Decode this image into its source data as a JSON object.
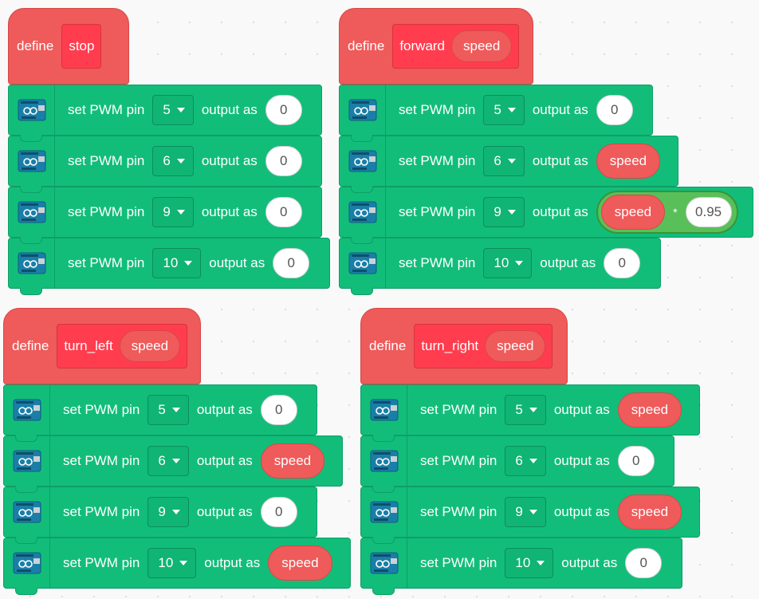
{
  "colors": {
    "motion_block": "#12bd7a",
    "define_hat": "#ef5a5a",
    "prototype": "#ff3d4f",
    "operator": "#59c059"
  },
  "scripts": [
    {
      "define_label": "define",
      "name": "stop",
      "args": [],
      "blocks": [
        {
          "label": "set PWM pin",
          "pin": "5",
          "output_label": "output as",
          "value": {
            "type": "number",
            "text": "0"
          }
        },
        {
          "label": "set PWM pin",
          "pin": "6",
          "output_label": "output as",
          "value": {
            "type": "number",
            "text": "0"
          }
        },
        {
          "label": "set PWM pin",
          "pin": "9",
          "output_label": "output as",
          "value": {
            "type": "number",
            "text": "0"
          }
        },
        {
          "label": "set PWM pin",
          "pin": "10",
          "output_label": "output as",
          "value": {
            "type": "number",
            "text": "0"
          }
        }
      ]
    },
    {
      "define_label": "define",
      "name": "forward",
      "args": [
        "speed"
      ],
      "blocks": [
        {
          "label": "set PWM pin",
          "pin": "5",
          "output_label": "output as",
          "value": {
            "type": "number",
            "text": "0"
          }
        },
        {
          "label": "set PWM pin",
          "pin": "6",
          "output_label": "output as",
          "value": {
            "type": "reporter",
            "text": "speed"
          }
        },
        {
          "label": "set PWM pin",
          "pin": "9",
          "output_label": "output as",
          "value": {
            "type": "operator",
            "left": "speed",
            "operator": "*",
            "right": "0.95"
          }
        },
        {
          "label": "set PWM pin",
          "pin": "10",
          "output_label": "output as",
          "value": {
            "type": "number",
            "text": "0"
          }
        }
      ]
    },
    {
      "define_label": "define",
      "name": "turn_left",
      "args": [
        "speed"
      ],
      "blocks": [
        {
          "label": "set PWM pin",
          "pin": "5",
          "output_label": "output as",
          "value": {
            "type": "number",
            "text": "0"
          }
        },
        {
          "label": "set PWM pin",
          "pin": "6",
          "output_label": "output as",
          "value": {
            "type": "reporter",
            "text": "speed"
          }
        },
        {
          "label": "set PWM pin",
          "pin": "9",
          "output_label": "output as",
          "value": {
            "type": "number",
            "text": "0"
          }
        },
        {
          "label": "set PWM pin",
          "pin": "10",
          "output_label": "output as",
          "value": {
            "type": "reporter",
            "text": "speed"
          }
        }
      ]
    },
    {
      "define_label": "define",
      "name": "turn_right",
      "args": [
        "speed"
      ],
      "blocks": [
        {
          "label": "set PWM pin",
          "pin": "5",
          "output_label": "output as",
          "value": {
            "type": "reporter",
            "text": "speed"
          }
        },
        {
          "label": "set PWM pin",
          "pin": "6",
          "output_label": "output as",
          "value": {
            "type": "number",
            "text": "0"
          }
        },
        {
          "label": "set PWM pin",
          "pin": "9",
          "output_label": "output as",
          "value": {
            "type": "reporter",
            "text": "speed"
          }
        },
        {
          "label": "set PWM pin",
          "pin": "10",
          "output_label": "output as",
          "value": {
            "type": "number",
            "text": "0"
          }
        }
      ]
    }
  ]
}
